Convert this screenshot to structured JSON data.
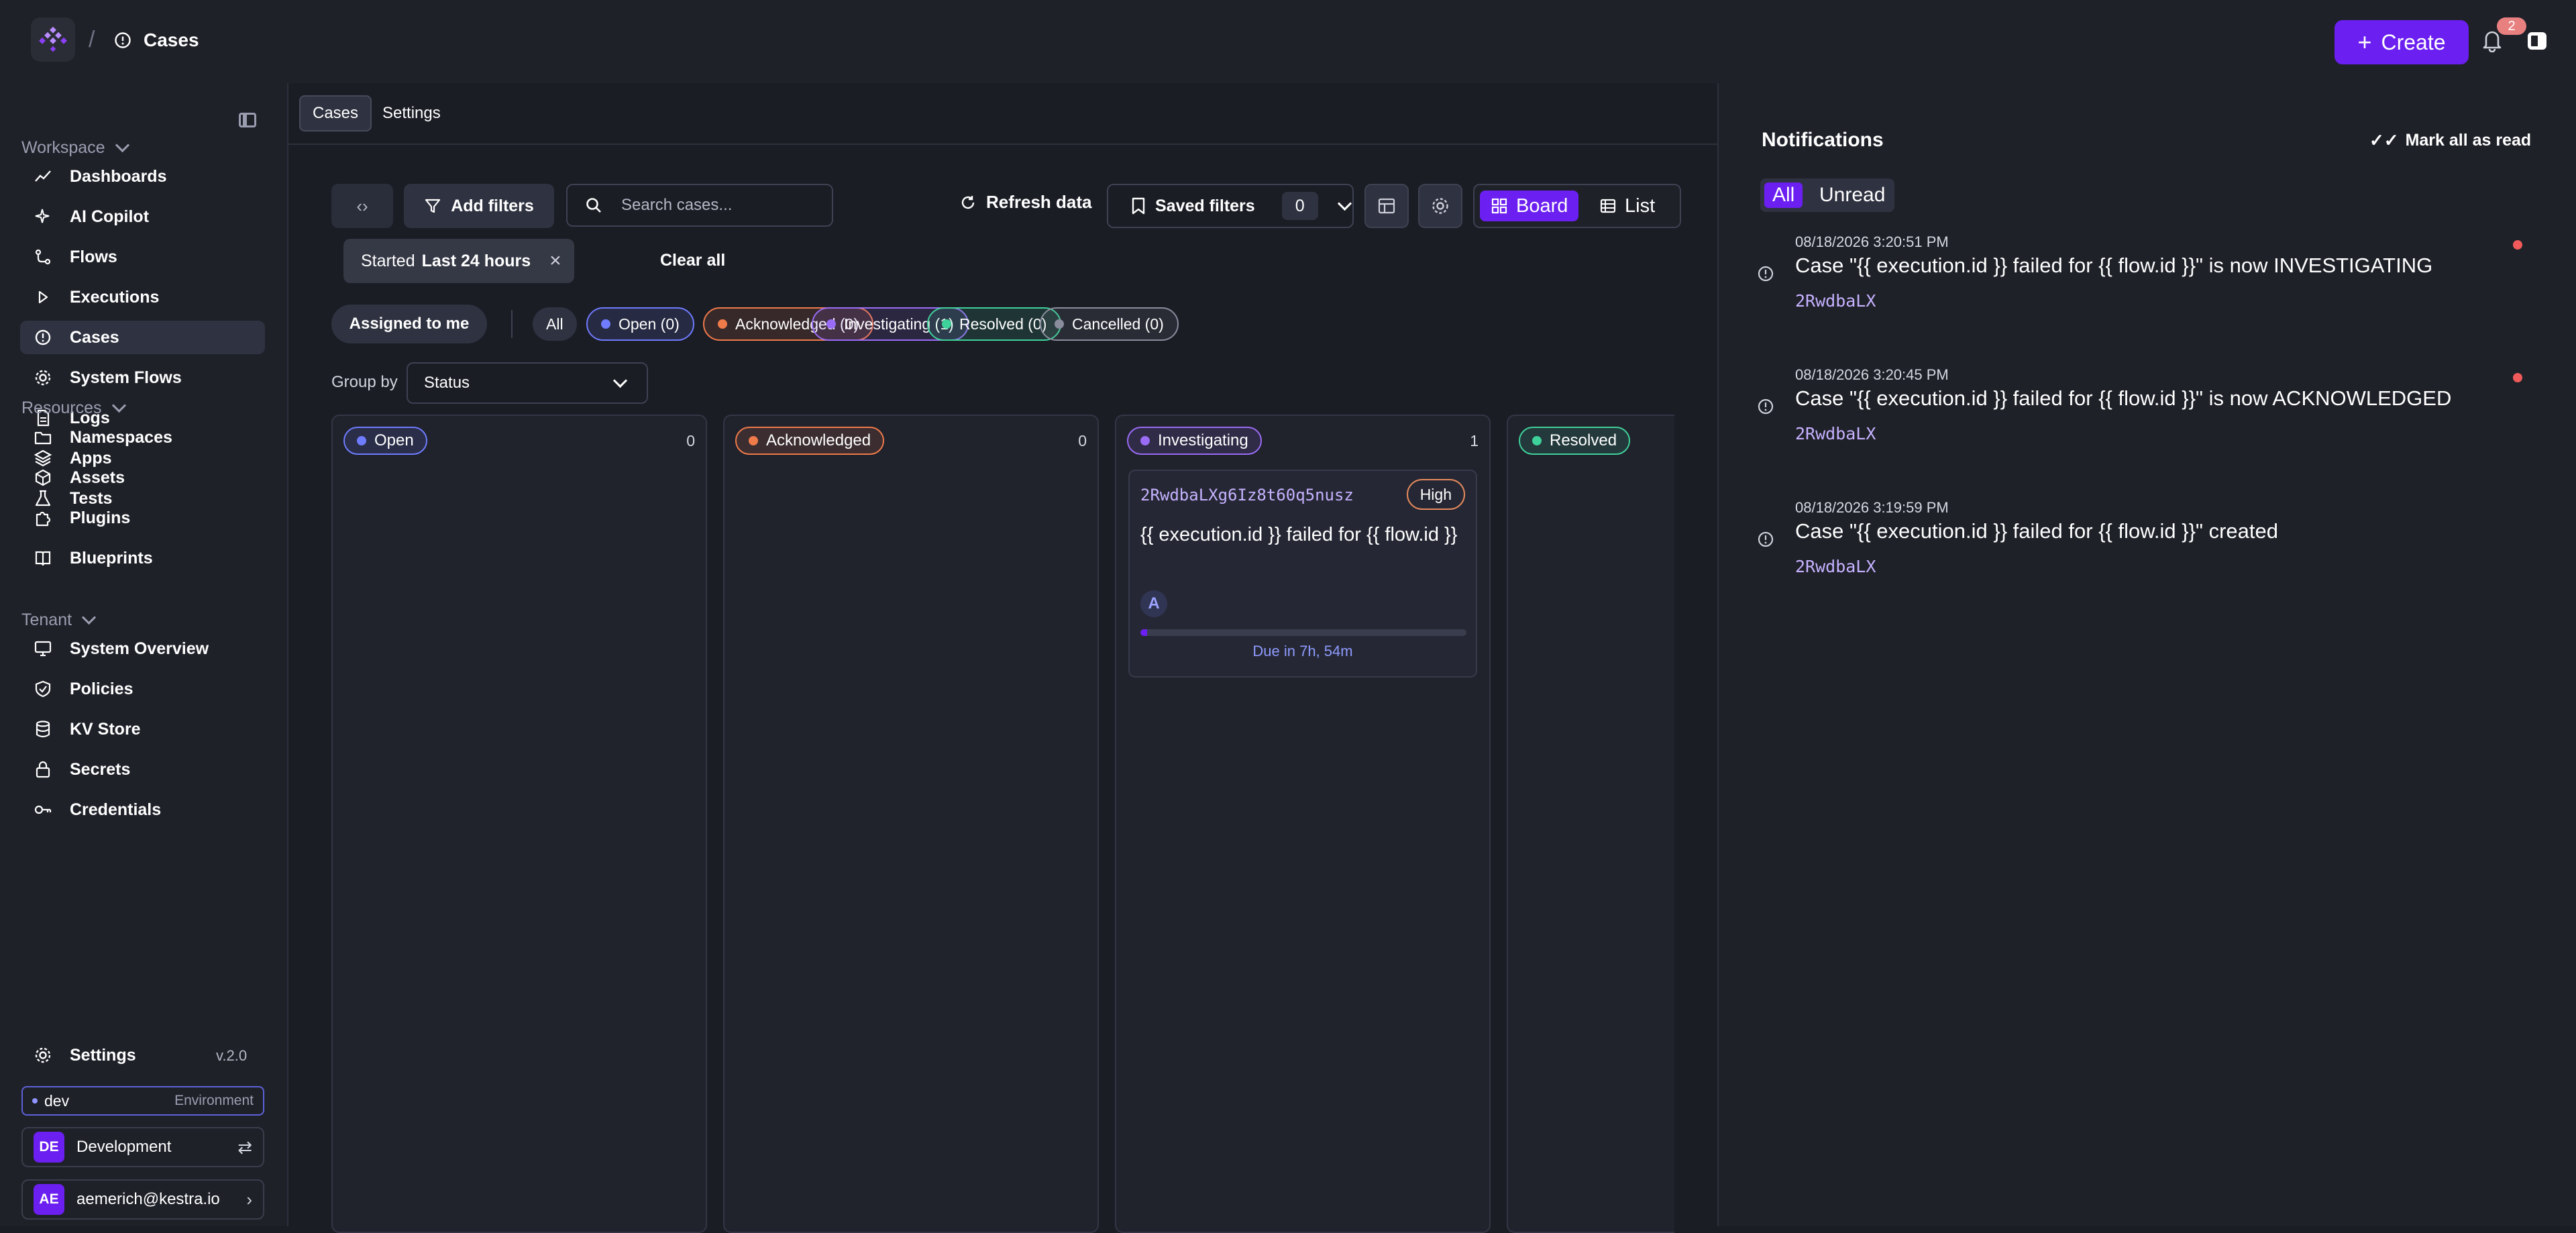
{
  "header": {
    "title": "Cases",
    "create_label": "Create",
    "notification_count": "2"
  },
  "sidebar": {
    "sections": [
      {
        "label": "Workspace",
        "items": [
          {
            "label": "Dashboards",
            "icon": "chart-line-icon"
          },
          {
            "label": "AI Copilot",
            "icon": "sparkles-icon"
          },
          {
            "label": "Flows",
            "icon": "flow-icon"
          },
          {
            "label": "Executions",
            "icon": "play-icon"
          },
          {
            "label": "Cases",
            "icon": "alert-circle-icon",
            "active": true
          },
          {
            "label": "System Flows",
            "icon": "gear-icon"
          },
          {
            "label": "Logs",
            "icon": "file-text-icon"
          },
          {
            "label": "Apps",
            "icon": "layers-icon"
          },
          {
            "label": "Tests",
            "icon": "flask-icon"
          }
        ]
      },
      {
        "label": "Resources",
        "items": [
          {
            "label": "Namespaces",
            "icon": "folder-icon"
          },
          {
            "label": "Assets",
            "icon": "cube-icon"
          },
          {
            "label": "Plugins",
            "icon": "puzzle-icon"
          },
          {
            "label": "Blueprints",
            "icon": "book-icon"
          }
        ]
      },
      {
        "label": "Tenant",
        "items": [
          {
            "label": "System Overview",
            "icon": "monitor-icon"
          },
          {
            "label": "Policies",
            "icon": "shield-check-icon"
          },
          {
            "label": "KV Store",
            "icon": "database-icon"
          },
          {
            "label": "Secrets",
            "icon": "lock-icon"
          },
          {
            "label": "Credentials",
            "icon": "key-icon"
          }
        ]
      }
    ],
    "settings_label": "Settings",
    "version": "v.2.0",
    "environment": {
      "value": "dev",
      "label": "Environment"
    },
    "tenant": {
      "initials": "DE",
      "name": "Development"
    },
    "user": {
      "initials": "AE",
      "email": "aemerich@kestra.io"
    }
  },
  "main": {
    "tabs": [
      "Cases",
      "Settings"
    ],
    "toolbar": {
      "add_filters": "Add filters",
      "search_placeholder": "Search cases...",
      "refresh": "Refresh data",
      "saved_filters": "Saved filters",
      "saved_count": "0",
      "views": [
        "Board",
        "List"
      ]
    },
    "active_filter": {
      "prefix": "Started",
      "value": "Last 24 hours"
    },
    "clear_all": "Clear all",
    "assigned_to_me": "Assigned to me",
    "status_pills": [
      {
        "label": "All",
        "color": ""
      },
      {
        "label": "Open (0)",
        "color": "#6f7cff"
      },
      {
        "label": "Acknowledged (0)",
        "color": "#ef7a4a"
      },
      {
        "label": "Investigating (1)",
        "color": "#9a6cf5"
      },
      {
        "label": "Resolved (0)",
        "color": "#3fd19a"
      },
      {
        "label": "Cancelled (0)",
        "color": "#8a8d9c"
      }
    ],
    "group_by_label": "Group by",
    "group_by_value": "Status",
    "columns": [
      {
        "label": "Open",
        "count": "0",
        "color": "#6f7cff"
      },
      {
        "label": "Acknowledged",
        "count": "0",
        "color": "#ef7a4a"
      },
      {
        "label": "Investigating",
        "count": "1",
        "color": "#9a6cf5"
      },
      {
        "label": "Resolved",
        "count": "",
        "color": "#3fd19a"
      }
    ],
    "card": {
      "id": "2RwdbaLXg6Iz8t60q5nusz",
      "priority": "High",
      "title": "{{ execution.id }} failed for {{ flow.id }}",
      "assignee": "A",
      "progress": 0.02,
      "due": "Due in 7h, 54m"
    }
  },
  "notifications": {
    "title": "Notifications",
    "mark_all": "Mark all as read",
    "tabs": [
      "All",
      "Unread"
    ],
    "items": [
      {
        "time": "08/18/2026 3:20:51 PM",
        "message": "Case \"{{ execution.id }} failed for {{ flow.id }}\" is now INVESTIGATING",
        "ref": "2RwdbaLX",
        "unread": true
      },
      {
        "time": "08/18/2026 3:20:45 PM",
        "message": "Case \"{{ execution.id }} failed for {{ flow.id }}\" is now ACKNOWLEDGED",
        "ref": "2RwdbaLX",
        "unread": true
      },
      {
        "time": "08/18/2026 3:19:59 PM",
        "message": "Case \"{{ execution.id }} failed for {{ flow.id }}\" created",
        "ref": "2RwdbaLX",
        "unread": false
      }
    ]
  }
}
